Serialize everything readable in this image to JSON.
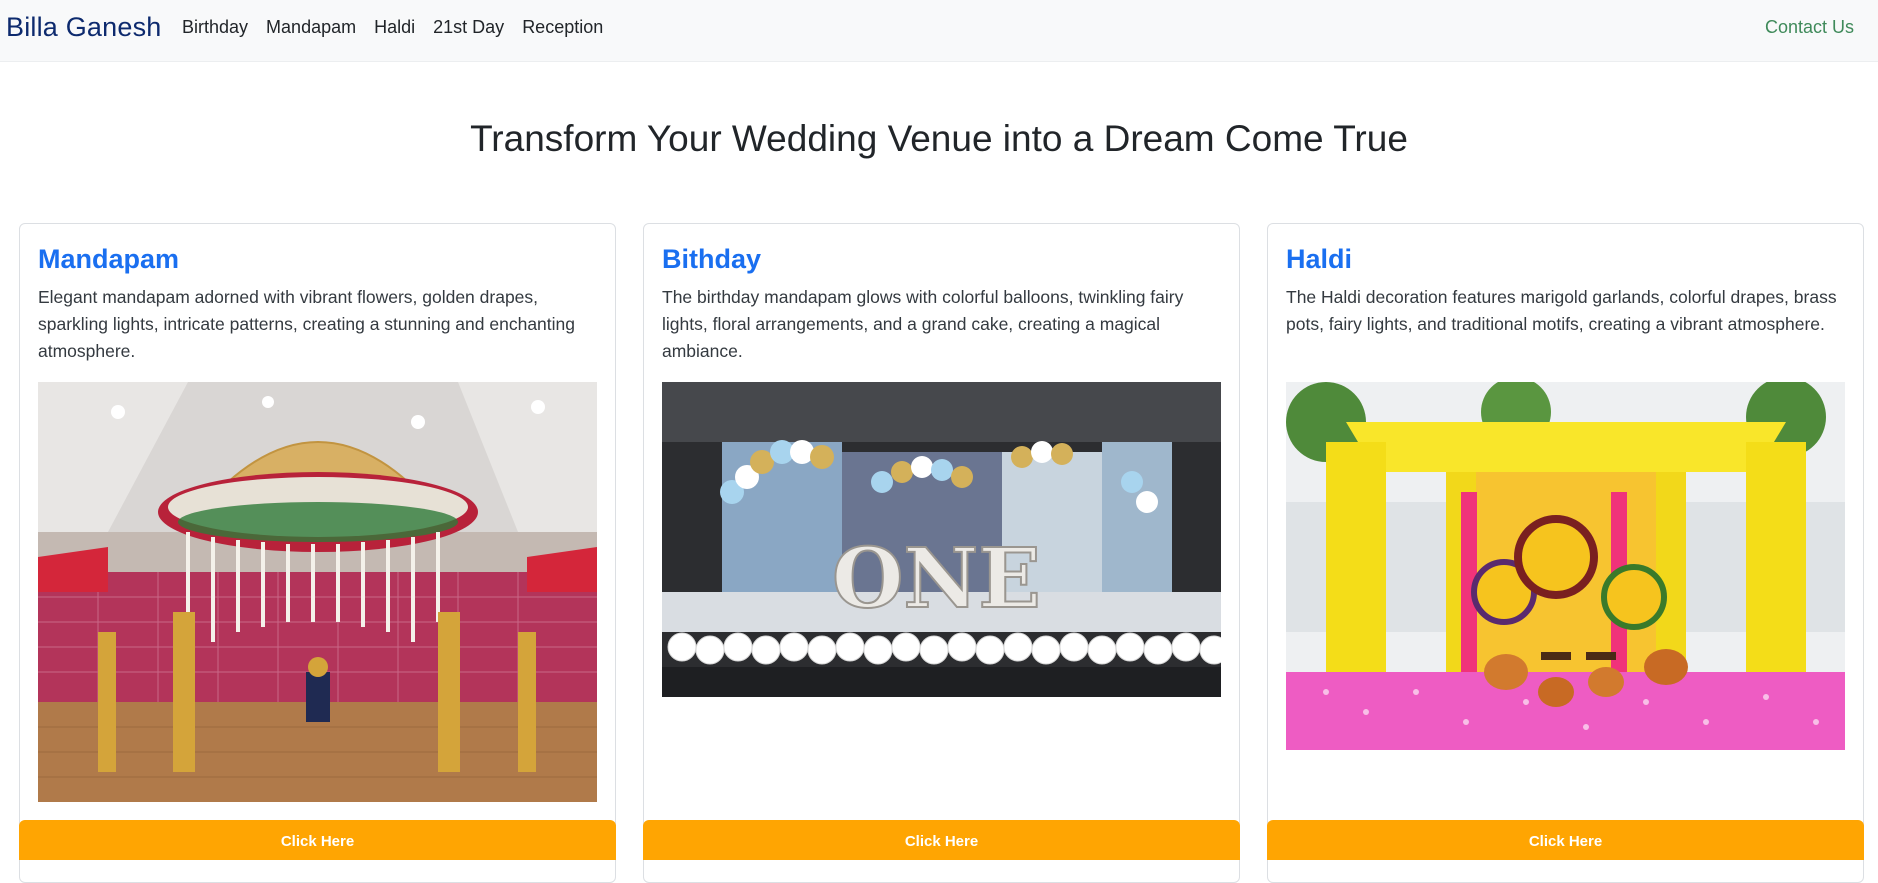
{
  "navbar": {
    "brand": "Billa Ganesh",
    "links": [
      "Birthday",
      "Mandapam",
      "Haldi",
      "21st Day",
      "Reception"
    ],
    "contact": "Contact Us"
  },
  "hero": {
    "title": "Transform Your Wedding Venue into a Dream Come True"
  },
  "cards": [
    {
      "title": "Mandapam",
      "text": "Elegant mandapam adorned with vibrant flowers, golden drapes, sparkling lights, intricate patterns, creating a stunning and enchanting atmosphere.",
      "image": "mandapam-decoration-photo",
      "button": "Click Here"
    },
    {
      "title": "Bithday",
      "text": "The birthday mandapam glows with colorful balloons, twinkling fairy lights, floral arrangements, and a grand cake, creating a magical ambiance.",
      "image": "birthday-stage-photo",
      "button": "Click Here"
    },
    {
      "title": "Haldi",
      "text": "The Haldi decoration features marigold garlands, colorful drapes, brass pots, fairy lights, and traditional motifs, creating a vibrant atmosphere.",
      "image": "haldi-decoration-photo",
      "button": "Click Here"
    }
  ],
  "colors": {
    "brand": "#0d2a6e",
    "card_title": "#1a6ff0",
    "button": "#ffa502",
    "contact": "#3f8a5a"
  }
}
